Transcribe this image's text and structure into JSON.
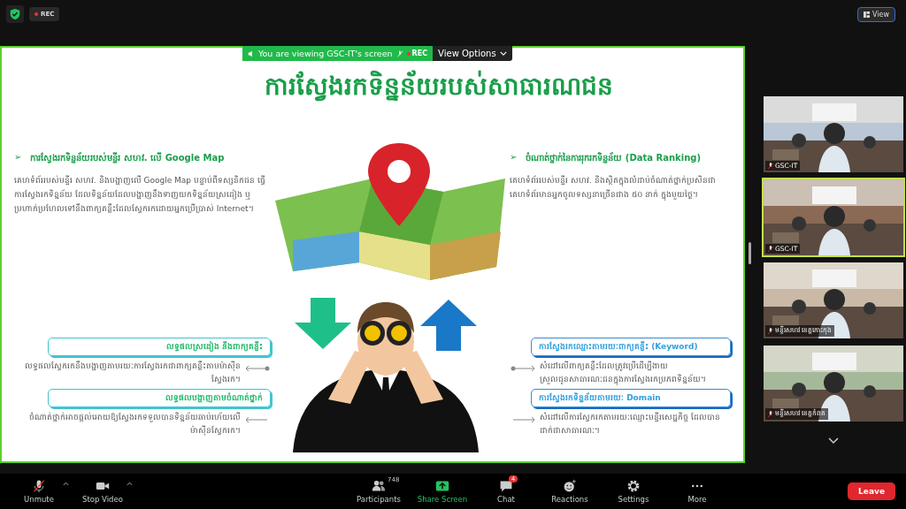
{
  "top_bar": {
    "rec_label": "REC",
    "view_button": "View"
  },
  "share_banner": {
    "text": "You are viewing GSC-IT's screen",
    "rec_label": "REC",
    "view_options": "View Options"
  },
  "slide": {
    "title": "ការស្វែងរកទិន្នន័យរបស់សាធារណជន",
    "left": {
      "bullet": "➢",
      "heading": "ការស្វែងរកទិន្នន័យរបស់មន្ទីរ សហវ. លើ Google Map",
      "body": "គេហទំព័ររបស់មន្ទីរ សហវ. និងបង្ហាញលើ Google Map បន្ទាប់ពីទស្សនិកជន ធ្វើការស្វែងរកទិន្នន័យ ដែលទិន្នន័យដែលបង្ហាញនឹងទាញយកទិន្នន័យស្រដៀង ឬប្រហាក់ប្រហែលទៅនឹងពាក្យគន្លឹះដែលស្វែករកដោយអ្នកប្រើប្រាស់ Internet។",
      "callouts": [
        {
          "heading": "លទ្ធផលស្រដៀង នឹងពាក្យគន្លឹះ",
          "body": "លទ្ធផលស្វែករកនឹងបង្ហាញតាមរយៈការស្វែងរកជាពាក្យគន្លឹះតាមម៉ាស៊ីនស្វែងរក។"
        },
        {
          "heading": "លទ្ធផលបង្ហាញតាមចំណាត់ថ្នាក់",
          "body": "ចំណាត់ថ្នាក់អាចផ្តល់អោយឱ្យស្វែងរកទទួលបានទិន្នន័យឆាប់រហ័យលើម៉ាស៊ីនស្វែករក។"
        }
      ]
    },
    "right": {
      "bullet": "➢",
      "heading": "ចំណាត់ថ្នាក់នៃការរុករកទិន្នន័យ (Data Ranking)",
      "body": "គេហទំព័ររបស់មន្ទីរ សហវ. និងស្ថិតក្នុងលំដាប់ចំណាត់ថ្នាក់ប្រសិនជាគេហទំព័រមានអ្នកចូលទស្សនាច្រើនជាង ៥០ នាក់ ក្នុងមួយថ្ងៃ។",
      "callouts": [
        {
          "heading": "ការស្វែងរកឈ្មោះតាមរយៈពាក្យគន្លឹះ (Keyword)",
          "body": "សំដៅលើពាក្យគន្លឹះដែលត្រូវប្រើដើម្បីងាយស្រួលជូនសាធារណៈជនក្នុងការស្វែងរកប្រភពទិន្នន័យ។"
        },
        {
          "heading": "ការស្វែងរកទិន្នន័យតាមរយៈ Domain",
          "body": "សំដៅលើការស្វែករកតាមរយៈឈ្មោះមន្ទីរសេដ្ឋកិច្ច ដែលបានដាក់ជាសាធារណៈ។"
        }
      ]
    }
  },
  "tiles": [
    {
      "name": "GSC-IT",
      "selected": false
    },
    {
      "name": "GSC-IT",
      "selected": true
    },
    {
      "name": "មន្ទីរសហវ ខេត្តកោះកុង",
      "selected": false
    },
    {
      "name": "មន្ទីរសហវ ខេត្តកំពត",
      "selected": false
    }
  ],
  "toolbar": {
    "items": [
      {
        "kind": "mic",
        "label": "Unmute"
      },
      {
        "kind": "video",
        "label": "Stop Video"
      },
      {
        "kind": "participants",
        "label": "Participants",
        "count": "748"
      },
      {
        "kind": "share",
        "label": "Share Screen"
      },
      {
        "kind": "chat",
        "label": "Chat",
        "count": "4"
      },
      {
        "kind": "reactions",
        "label": "Reactions"
      },
      {
        "kind": "settings",
        "label": "Settings"
      },
      {
        "kind": "more",
        "label": "More"
      }
    ],
    "leave": "Leave"
  }
}
